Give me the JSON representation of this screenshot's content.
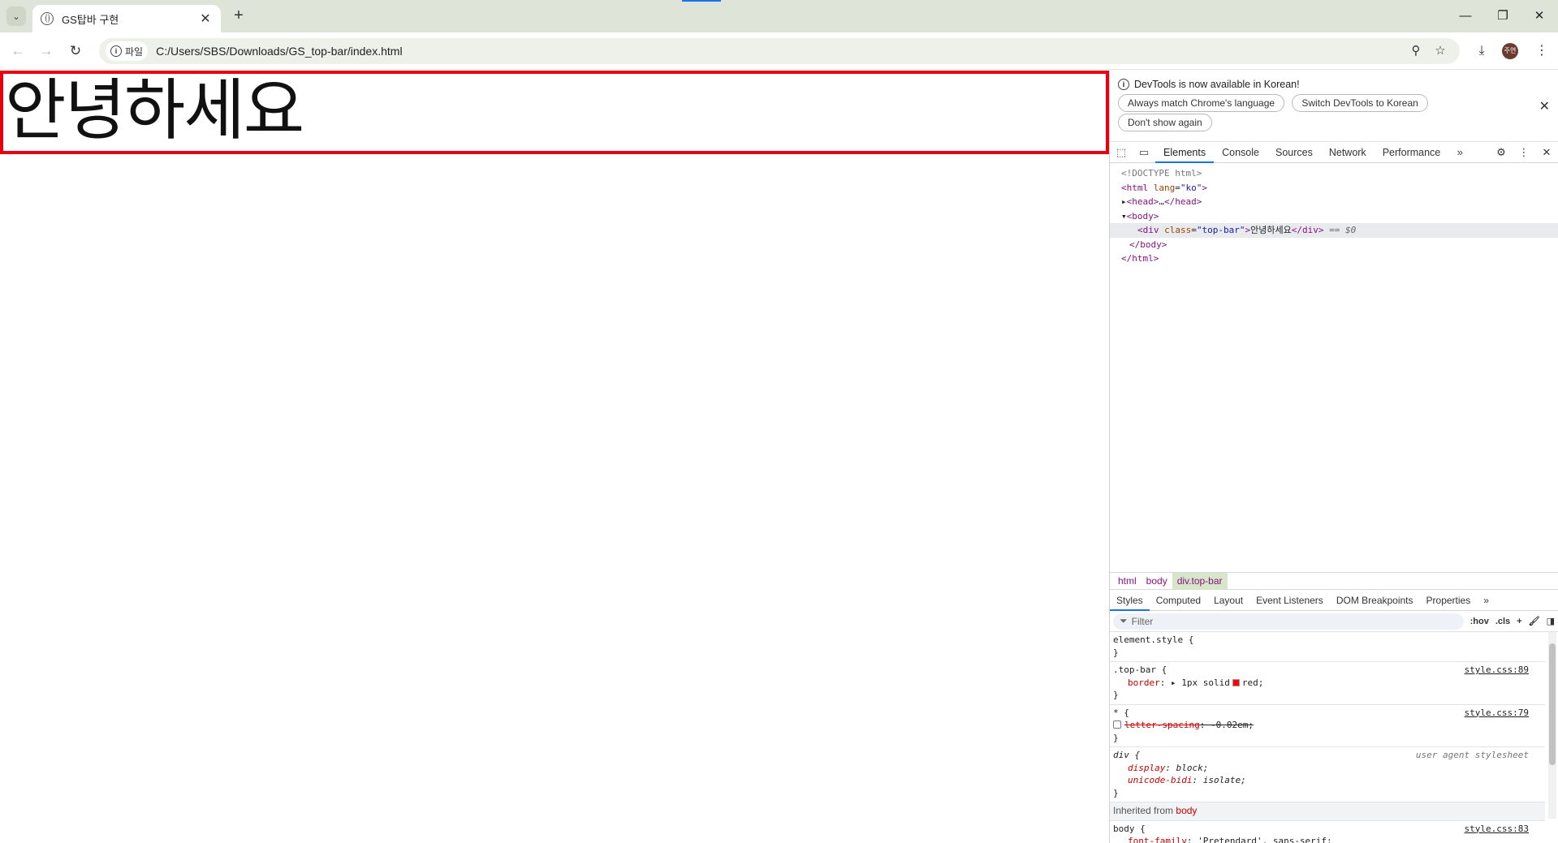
{
  "browser": {
    "tab_title": "GS탑바 구현",
    "url_chip_label": "파일",
    "url": "C:/Users/SBS/Downloads/GS_top-bar/index.html",
    "avatar_text": "주연"
  },
  "page": {
    "top_bar_text": "안녕하세요"
  },
  "devtools": {
    "infobar": {
      "message": "DevTools is now available in Korean!",
      "buttons": [
        "Always match Chrome's language",
        "Switch DevTools to Korean",
        "Don't show again"
      ]
    },
    "tabs": [
      "Elements",
      "Console",
      "Sources",
      "Network",
      "Performance"
    ],
    "active_tab": "Elements",
    "dom": {
      "doctype": "<!DOCTYPE html>",
      "html_open_tag": "<html",
      "html_lang_attr": "lang",
      "html_lang_value": "\"ko\"",
      "head_collapsed": "<head>",
      "head_ellipsis": "…",
      "head_close": "</head>",
      "body_open": "<body>",
      "div_open": "<div",
      "div_class_attr": "class",
      "div_class_value": "\"top-bar\"",
      "div_text": "안녕하세요",
      "div_close": "</div>",
      "selected_marker": "== $0",
      "body_close": "</body>",
      "html_close": "</html>"
    },
    "breadcrumbs": [
      "html",
      "body",
      "div.top-bar"
    ],
    "sub_tabs": [
      "Styles",
      "Computed",
      "Layout",
      "Event Listeners",
      "DOM Breakpoints",
      "Properties"
    ],
    "filter_placeholder": "Filter",
    "filter_tools": [
      ":hov",
      ".cls"
    ],
    "styles": {
      "element_style": "element.style {",
      "top_bar_selector": ".top-bar {",
      "top_bar_source": "style.css:89",
      "border_prop": "border",
      "border_value_a": "1px solid",
      "border_value_b": "red;",
      "star_selector": "* {",
      "star_source": "style.css:79",
      "letter_spacing_prop": "letter-spacing",
      "letter_spacing_value": "-0.02em;",
      "div_selector": "div {",
      "ua_source": "user agent stylesheet",
      "display_prop": "display",
      "display_value": "block;",
      "unicode_prop": "unicode-bidi",
      "unicode_value": "isolate;",
      "inherited_label": "Inherited from",
      "inherited_from": "body",
      "body_selector": "body {",
      "body_source": "style.css:83",
      "font_family_prop": "font-family",
      "font_family_value": "'Pretendard', sans-serif;",
      "close_brace": "}"
    }
  }
}
